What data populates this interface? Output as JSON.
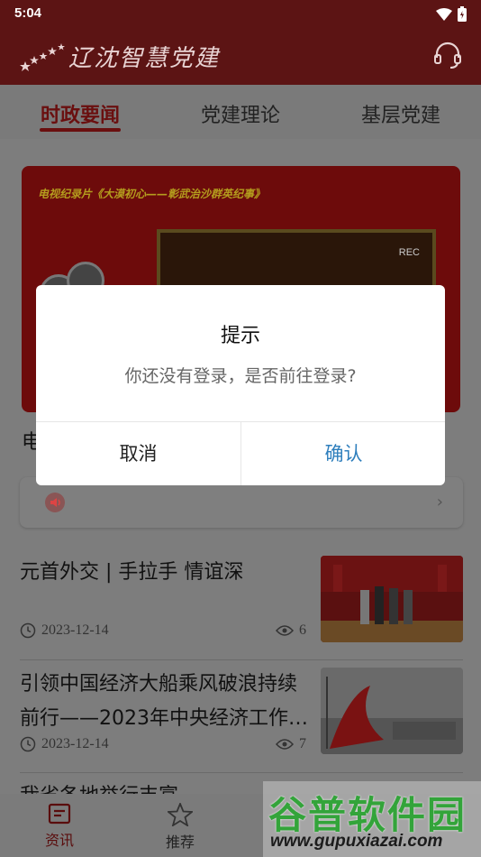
{
  "status_bar": {
    "time": "5:04"
  },
  "header": {
    "title": "辽沈智慧党建"
  },
  "tabs": [
    {
      "label": "时政要闻",
      "active": true
    },
    {
      "label": "党建理论",
      "active": false
    },
    {
      "label": "基层党建",
      "active": false
    }
  ],
  "banner": {
    "caption": "电视纪录片《大漠初心——彰武治沙群英纪事》",
    "rec": "REC",
    "title_partial": "电"
  },
  "news": [
    {
      "title": "元首外交 | 手拉手 情谊深",
      "date": "2023-12-14",
      "views": "6"
    },
    {
      "title": "引领中国经济大船乘风破浪持续前行——2023年中央经济工作…",
      "date": "2023-12-14",
      "views": "7"
    },
    {
      "title": "我省各地举行丰富..."
    }
  ],
  "bottom_nav": [
    {
      "label": "资讯",
      "icon": "news-icon",
      "active": true
    },
    {
      "label": "推荐",
      "icon": "star-icon",
      "active": false
    }
  ],
  "dialog": {
    "title": "提示",
    "message": "你还没有登录，是否前往登录?",
    "cancel": "取消",
    "confirm": "确认"
  },
  "watermark": {
    "main": "谷普软件园",
    "url": "www.gupuxiazai.com"
  },
  "colors": {
    "header_bg": "#5c1414",
    "accent": "#6a0f0f",
    "confirm_blue": "#2f7fbd"
  }
}
